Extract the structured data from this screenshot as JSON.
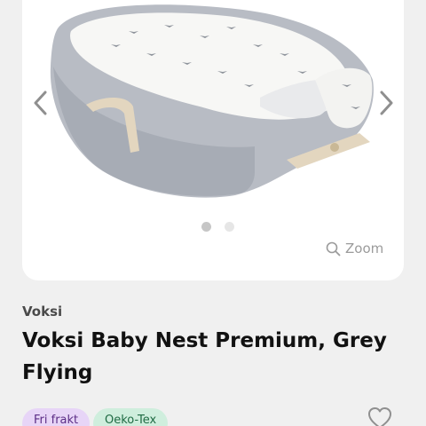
{
  "product": {
    "brand": "Voksi",
    "title": "Voksi Baby Nest Premium, Grey Flying",
    "image_alt": "Voksi Baby Nest Premium, Grey Flying"
  },
  "gallery": {
    "zoom_label": "Zoom",
    "slide_count": 2,
    "active_slide": 1
  },
  "tags": [
    "Fri frakt",
    "Oeko-Tex"
  ],
  "icons": {
    "prev": "chevron-left-icon",
    "next": "chevron-right-icon",
    "zoom": "magnifier-icon",
    "favorite": "heart-outline-icon"
  },
  "colors": {
    "page_bg": "#f0f0f0",
    "card_bg": "#ffffff",
    "tag_purple_bg": "#e7d5f7",
    "tag_green_bg": "#cfeedd"
  }
}
